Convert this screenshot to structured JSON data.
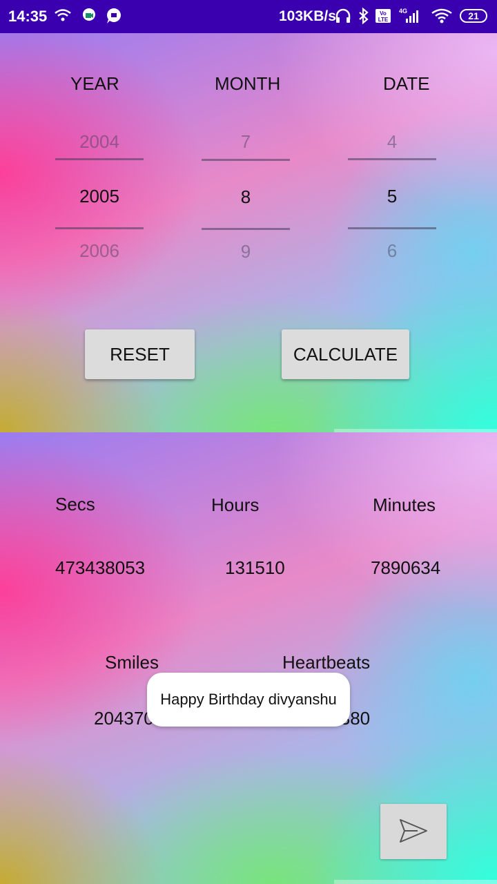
{
  "status": {
    "time": "14:35",
    "speed": "103KB/s",
    "battery": "21",
    "network": "4G"
  },
  "picker": {
    "year_label": "YEAR",
    "month_label": "MONTH",
    "date_label": "DATE",
    "year": {
      "prev": "2004",
      "current": "2005",
      "next": "2006"
    },
    "month": {
      "prev": "7",
      "current": "8",
      "next": "9"
    },
    "date": {
      "prev": "4",
      "current": "5",
      "next": "6"
    }
  },
  "buttons": {
    "reset": "RESET",
    "calculate": "CALCULATE"
  },
  "results": {
    "secs_label": "Secs",
    "hours_label": "Hours",
    "minutes_label": "Minutes",
    "secs_value": "473438053",
    "hours_value": "131510",
    "minutes_value": "7890634",
    "smiles_label": "Smiles",
    "heartbeats_label": "Heartbeats",
    "smiles_value": "204370",
    "heartbeats_value": "552344380"
  },
  "toast": "Happy Birthday divyanshu",
  "icons": {
    "send": "send-icon"
  }
}
